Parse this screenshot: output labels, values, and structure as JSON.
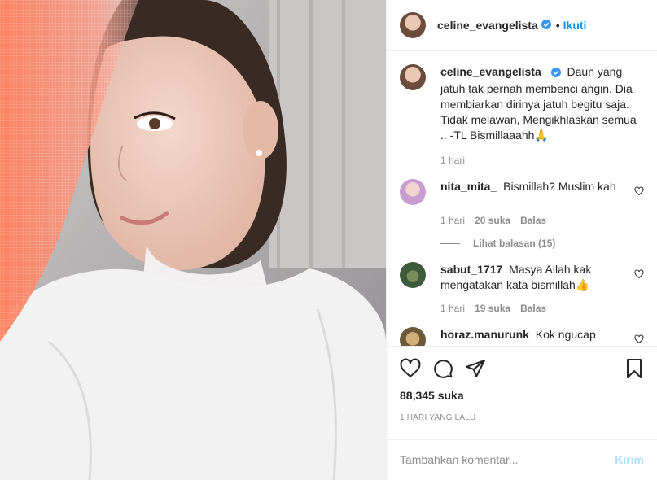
{
  "header": {
    "username": "celine_evangelista",
    "dot": "•",
    "follow_label": "Ikuti"
  },
  "caption": {
    "username": "celine_evangelista",
    "text": "Daun yang jatuh tak pernah membenci angin. Dia membiarkan dirinya jatuh begitu saja. Tidak melawan, Mengikhlaskan semua .. -TL Bismillaaahh🙏",
    "time": "1 hari"
  },
  "comments": [
    {
      "username": "nita_mita_",
      "text": "Bismillah? Muslim kah",
      "time": "1 hari",
      "likes": "20 suka",
      "reply": "Balas",
      "view_replies": "Lihat balasan (15)"
    },
    {
      "username": "sabut_1717",
      "text": "Masya Allah kak mengatakan kata bismillah👍",
      "time": "1 hari",
      "likes": "19 suka",
      "reply": "Balas"
    },
    {
      "username": "horaz.manurunk",
      "text": "Kok ngucap"
    }
  ],
  "actions": {
    "likes": "88,345 suka",
    "timestamp": "1 HARI YANG LALU"
  },
  "add_comment": {
    "placeholder": "Tambahkan komentar...",
    "post_label": "Kirim"
  },
  "icons": {
    "verified": "verified-badge-icon",
    "like": "heart-icon",
    "comment": "comment-icon",
    "share": "paper-plane-icon",
    "save": "bookmark-icon"
  },
  "colors": {
    "accent": "#0095f6",
    "post_disabled": "#b2dffc",
    "muted": "#8e8e8e",
    "text": "#262626"
  }
}
